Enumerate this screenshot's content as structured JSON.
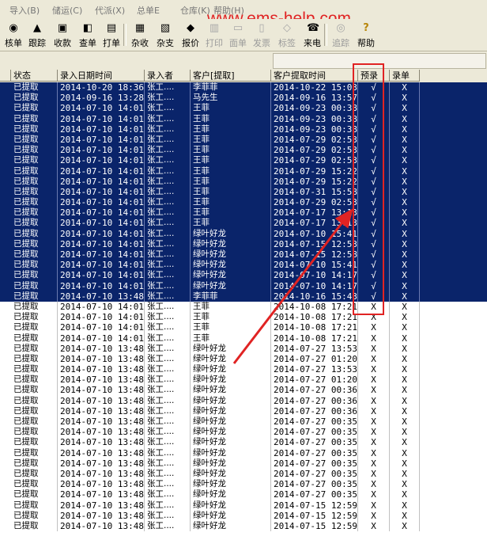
{
  "menu": [
    "导入(B)",
    "储运(C)",
    "代派(X)",
    "总单E",
    "仓库(K)",
    "帮助(H)"
  ],
  "watermark": "www.ems-help.com",
  "toolbar": {
    "buttons": [
      {
        "label": "核单",
        "icon": "eye-icon",
        "enabled": true
      },
      {
        "label": "跟踪",
        "icon": "warning-icon",
        "enabled": true
      },
      {
        "label": "收款",
        "icon": "cash-icon",
        "enabled": true
      },
      {
        "label": "查单",
        "icon": "find-icon",
        "enabled": true
      },
      {
        "label": "打单",
        "icon": "print-icon",
        "enabled": true
      },
      {
        "label": "杂收",
        "icon": "collect-icon",
        "enabled": true
      },
      {
        "label": "杂支",
        "icon": "pay-icon",
        "enabled": true
      },
      {
        "label": "报价",
        "icon": "quote-icon",
        "enabled": true
      },
      {
        "label": "打印",
        "icon": "printer-icon",
        "enabled": false
      },
      {
        "label": "面单",
        "icon": "sheet-icon",
        "enabled": false
      },
      {
        "label": "发票",
        "icon": "invoice-icon",
        "enabled": false
      },
      {
        "label": "标签",
        "icon": "tag-icon",
        "enabled": false
      },
      {
        "label": "来电",
        "icon": "phone-icon",
        "enabled": true
      },
      {
        "label": "追踪",
        "icon": "track-icon",
        "enabled": false
      },
      {
        "label": "帮助",
        "icon": "help-icon",
        "enabled": true
      }
    ]
  },
  "columns": [
    "状态",
    "录入日期时间",
    "录入者",
    "客户[提取]",
    "客户提取时间",
    "预录",
    "录单"
  ],
  "rows": [
    {
      "status": "已提取",
      "entry": "2014-10-20 18:36",
      "user": "张工....",
      "customer": "李菲菲",
      "pickup": "2014-10-22 15:03",
      "pre": "√",
      "rec": "X",
      "sel": true
    },
    {
      "status": "已提取",
      "entry": "2014-09-16 13:28",
      "user": "张工....",
      "customer": "马先生",
      "pickup": "2014-09-16 13:57",
      "pre": "√",
      "rec": "X",
      "sel": true
    },
    {
      "status": "已提取",
      "entry": "2014-07-10 14:01",
      "user": "张工....",
      "customer": "王菲",
      "pickup": "2014-09-23 00:38",
      "pre": "√",
      "rec": "X",
      "sel": true
    },
    {
      "status": "已提取",
      "entry": "2014-07-10 14:01",
      "user": "张工....",
      "customer": "王菲",
      "pickup": "2014-09-23 00:38",
      "pre": "√",
      "rec": "X",
      "sel": true
    },
    {
      "status": "已提取",
      "entry": "2014-07-10 14:01",
      "user": "张工....",
      "customer": "王菲",
      "pickup": "2014-09-23 00:38",
      "pre": "√",
      "rec": "X",
      "sel": true
    },
    {
      "status": "已提取",
      "entry": "2014-07-10 14:01",
      "user": "张工....",
      "customer": "王菲",
      "pickup": "2014-07-29 02:53",
      "pre": "√",
      "rec": "X",
      "sel": true
    },
    {
      "status": "已提取",
      "entry": "2014-07-10 14:01",
      "user": "张工....",
      "customer": "王菲",
      "pickup": "2014-07-29 02:53",
      "pre": "√",
      "rec": "X",
      "sel": true
    },
    {
      "status": "已提取",
      "entry": "2014-07-10 14:01",
      "user": "张工....",
      "customer": "王菲",
      "pickup": "2014-07-29 02:53",
      "pre": "√",
      "rec": "X",
      "sel": true
    },
    {
      "status": "已提取",
      "entry": "2014-07-10 14:01",
      "user": "张工....",
      "customer": "王菲",
      "pickup": "2014-07-29 15:22",
      "pre": "√",
      "rec": "X",
      "sel": true
    },
    {
      "status": "已提取",
      "entry": "2014-07-10 14:01",
      "user": "张工....",
      "customer": "王菲",
      "pickup": "2014-07-29 15:22",
      "pre": "√",
      "rec": "X",
      "sel": true
    },
    {
      "status": "已提取",
      "entry": "2014-07-10 14:01",
      "user": "张工....",
      "customer": "王菲",
      "pickup": "2014-07-31 15:58",
      "pre": "√",
      "rec": "X",
      "sel": true
    },
    {
      "status": "已提取",
      "entry": "2014-07-10 14:01",
      "user": "张工....",
      "customer": "王菲",
      "pickup": "2014-07-29 02:53",
      "pre": "√",
      "rec": "X",
      "sel": true
    },
    {
      "status": "已提取",
      "entry": "2014-07-10 14:01",
      "user": "张工....",
      "customer": "王菲",
      "pickup": "2014-07-17 13:13",
      "pre": "√",
      "rec": "X",
      "sel": true
    },
    {
      "status": "已提取",
      "entry": "2014-07-10 14:01",
      "user": "张工....",
      "customer": "王菲",
      "pickup": "2014-07-17 13:13",
      "pre": "√",
      "rec": "X",
      "sel": true
    },
    {
      "status": "已提取",
      "entry": "2014-07-10 14:01",
      "user": "张工....",
      "customer": "绿叶好龙",
      "pickup": "2014-07-10 15:41",
      "pre": "√",
      "rec": "X",
      "sel": true
    },
    {
      "status": "已提取",
      "entry": "2014-07-10 14:01",
      "user": "张工....",
      "customer": "绿叶好龙",
      "pickup": "2014-07-15 12:53",
      "pre": "√",
      "rec": "X",
      "sel": true
    },
    {
      "status": "已提取",
      "entry": "2014-07-10 14:01",
      "user": "张工....",
      "customer": "绿叶好龙",
      "pickup": "2014-07-15 12:58",
      "pre": "√",
      "rec": "X",
      "sel": true
    },
    {
      "status": "已提取",
      "entry": "2014-07-10 14:01",
      "user": "张工....",
      "customer": "绿叶好龙",
      "pickup": "2014-07-10 15:41",
      "pre": "√",
      "rec": "X",
      "sel": true
    },
    {
      "status": "已提取",
      "entry": "2014-07-10 14:01",
      "user": "张工....",
      "customer": "绿叶好龙",
      "pickup": "2014-07-10 14:17",
      "pre": "√",
      "rec": "X",
      "sel": true
    },
    {
      "status": "已提取",
      "entry": "2014-07-10 14:01",
      "user": "张工....",
      "customer": "绿叶好龙",
      "pickup": "2014-07-10 14:17",
      "pre": "√",
      "rec": "X",
      "sel": true
    },
    {
      "status": "已提取",
      "entry": "2014-07-10 13:48",
      "user": "张工....",
      "customer": "李菲菲",
      "pickup": "2014-10-16 15:43",
      "pre": "√",
      "rec": "X",
      "sel": true
    },
    {
      "status": "已提取",
      "entry": "2014-07-10 14:01",
      "user": "张工....",
      "customer": "王菲",
      "pickup": "2014-10-08 17:21",
      "pre": "X",
      "rec": "X",
      "sel": false
    },
    {
      "status": "已提取",
      "entry": "2014-07-10 14:01",
      "user": "张工....",
      "customer": "王菲",
      "pickup": "2014-10-08 17:21",
      "pre": "X",
      "rec": "X",
      "sel": false
    },
    {
      "status": "已提取",
      "entry": "2014-07-10 14:01",
      "user": "张工....",
      "customer": "王菲",
      "pickup": "2014-10-08 17:21",
      "pre": "X",
      "rec": "X",
      "sel": false
    },
    {
      "status": "已提取",
      "entry": "2014-07-10 14:01",
      "user": "张工....",
      "customer": "王菲",
      "pickup": "2014-10-08 17:21",
      "pre": "X",
      "rec": "X",
      "sel": false
    },
    {
      "status": "已提取",
      "entry": "2014-07-10 13:48",
      "user": "张工....",
      "customer": "绿叶好龙",
      "pickup": "2014-07-27 13:53",
      "pre": "X",
      "rec": "X",
      "sel": false
    },
    {
      "status": "已提取",
      "entry": "2014-07-10 13:48",
      "user": "张工....",
      "customer": "绿叶好龙",
      "pickup": "2014-07-27 01:20",
      "pre": "X",
      "rec": "X",
      "sel": false
    },
    {
      "status": "已提取",
      "entry": "2014-07-10 13:48",
      "user": "张工....",
      "customer": "绿叶好龙",
      "pickup": "2014-07-27 13:53",
      "pre": "X",
      "rec": "X",
      "sel": false
    },
    {
      "status": "已提取",
      "entry": "2014-07-10 13:48",
      "user": "张工....",
      "customer": "绿叶好龙",
      "pickup": "2014-07-27 01:20",
      "pre": "X",
      "rec": "X",
      "sel": false
    },
    {
      "status": "已提取",
      "entry": "2014-07-10 13:48",
      "user": "张工....",
      "customer": "绿叶好龙",
      "pickup": "2014-07-27 00:36",
      "pre": "X",
      "rec": "X",
      "sel": false
    },
    {
      "status": "已提取",
      "entry": "2014-07-10 13:48",
      "user": "张工....",
      "customer": "绿叶好龙",
      "pickup": "2014-07-27 00:36",
      "pre": "X",
      "rec": "X",
      "sel": false
    },
    {
      "status": "已提取",
      "entry": "2014-07-10 13:48",
      "user": "张工....",
      "customer": "绿叶好龙",
      "pickup": "2014-07-27 00:36",
      "pre": "X",
      "rec": "X",
      "sel": false
    },
    {
      "status": "已提取",
      "entry": "2014-07-10 13:48",
      "user": "张工....",
      "customer": "绿叶好龙",
      "pickup": "2014-07-27 00:35",
      "pre": "X",
      "rec": "X",
      "sel": false
    },
    {
      "status": "已提取",
      "entry": "2014-07-10 13:48",
      "user": "张工....",
      "customer": "绿叶好龙",
      "pickup": "2014-07-27 00:35",
      "pre": "X",
      "rec": "X",
      "sel": false
    },
    {
      "status": "已提取",
      "entry": "2014-07-10 13:48",
      "user": "张工....",
      "customer": "绿叶好龙",
      "pickup": "2014-07-27 00:35",
      "pre": "X",
      "rec": "X",
      "sel": false
    },
    {
      "status": "已提取",
      "entry": "2014-07-10 13:48",
      "user": "张工....",
      "customer": "绿叶好龙",
      "pickup": "2014-07-27 00:35",
      "pre": "X",
      "rec": "X",
      "sel": false
    },
    {
      "status": "已提取",
      "entry": "2014-07-10 13:48",
      "user": "张工....",
      "customer": "绿叶好龙",
      "pickup": "2014-07-27 00:35",
      "pre": "X",
      "rec": "X",
      "sel": false
    },
    {
      "status": "已提取",
      "entry": "2014-07-10 13:48",
      "user": "张工....",
      "customer": "绿叶好龙",
      "pickup": "2014-07-27 00:35",
      "pre": "X",
      "rec": "X",
      "sel": false
    },
    {
      "status": "已提取",
      "entry": "2014-07-10 13:48",
      "user": "张工....",
      "customer": "绿叶好龙",
      "pickup": "2014-07-27 00:35",
      "pre": "X",
      "rec": "X",
      "sel": false
    },
    {
      "status": "已提取",
      "entry": "2014-07-10 13:48",
      "user": "张工....",
      "customer": "绿叶好龙",
      "pickup": "2014-07-27 00:35",
      "pre": "X",
      "rec": "X",
      "sel": false
    },
    {
      "status": "已提取",
      "entry": "2014-07-10 13:48",
      "user": "张工....",
      "customer": "绿叶好龙",
      "pickup": "2014-07-15 12:59",
      "pre": "X",
      "rec": "X",
      "sel": false
    },
    {
      "status": "已提取",
      "entry": "2014-07-10 13:48",
      "user": "张工....",
      "customer": "绿叶好龙",
      "pickup": "2014-07-15 12:59",
      "pre": "X",
      "rec": "X",
      "sel": false
    },
    {
      "status": "已提取",
      "entry": "2014-07-10 13:48",
      "user": "张工....",
      "customer": "绿叶好龙",
      "pickup": "2014-07-15 12:59",
      "pre": "X",
      "rec": "X",
      "sel": false
    }
  ],
  "colors": {
    "selection": "#0a246a",
    "annotation": "#e02323"
  }
}
